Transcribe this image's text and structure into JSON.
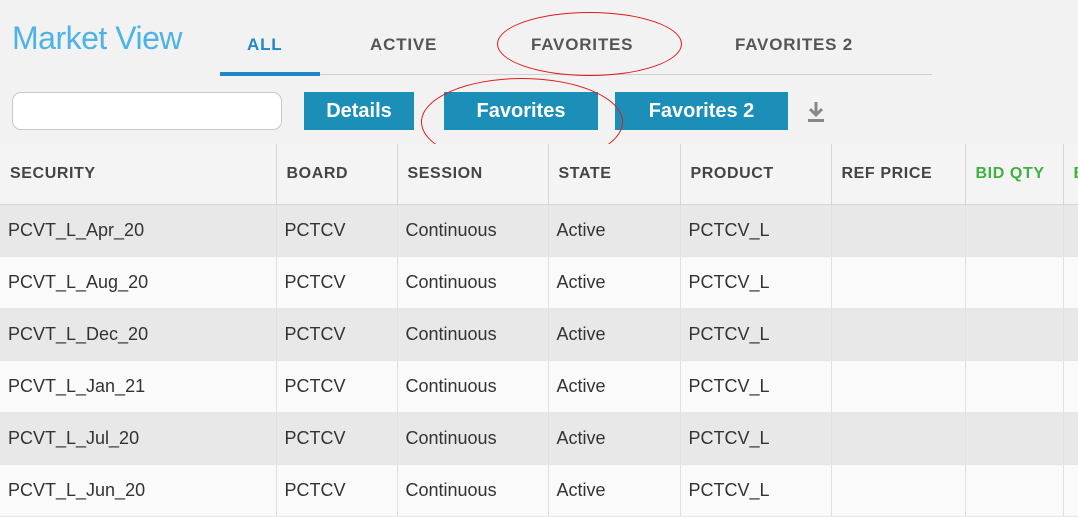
{
  "header": {
    "title": "Market View",
    "tabs": [
      {
        "label": "ALL",
        "active": true
      },
      {
        "label": "ACTIVE",
        "active": false
      },
      {
        "label": "FAVORITES",
        "active": false
      },
      {
        "label": "FAVORITES 2",
        "active": false
      }
    ]
  },
  "toolbar": {
    "search_value": "",
    "buttons": [
      "Details",
      "Favorites",
      "Favorites 2"
    ],
    "download_icon": "download-icon"
  },
  "table": {
    "columns": [
      "SECURITY",
      "BOARD",
      "SESSION",
      "STATE",
      "PRODUCT",
      "REF PRICE",
      "BID QTY",
      "B"
    ],
    "rows": [
      [
        "PCVT_L_Apr_20",
        "PCTCV",
        "Continuous",
        "Active",
        "PCTCV_L",
        "",
        "",
        ""
      ],
      [
        "PCVT_L_Aug_20",
        "PCTCV",
        "Continuous",
        "Active",
        "PCTCV_L",
        "",
        "",
        ""
      ],
      [
        "PCVT_L_Dec_20",
        "PCTCV",
        "Continuous",
        "Active",
        "PCTCV_L",
        "",
        "",
        ""
      ],
      [
        "PCVT_L_Jan_21",
        "PCTCV",
        "Continuous",
        "Active",
        "PCTCV_L",
        "",
        "",
        ""
      ],
      [
        "PCVT_L_Jul_20",
        "PCTCV",
        "Continuous",
        "Active",
        "PCTCV_L",
        "",
        "",
        ""
      ],
      [
        "PCVT_L_Jun_20",
        "PCTCV",
        "Continuous",
        "Active",
        "PCTCV_L",
        "",
        "",
        ""
      ]
    ]
  },
  "colors": {
    "accent": "#1e88c8",
    "title": "#4db3e6",
    "button": "#1b8fb8",
    "bid_header": "#3fb13f",
    "annotation": "#e01b1b"
  }
}
